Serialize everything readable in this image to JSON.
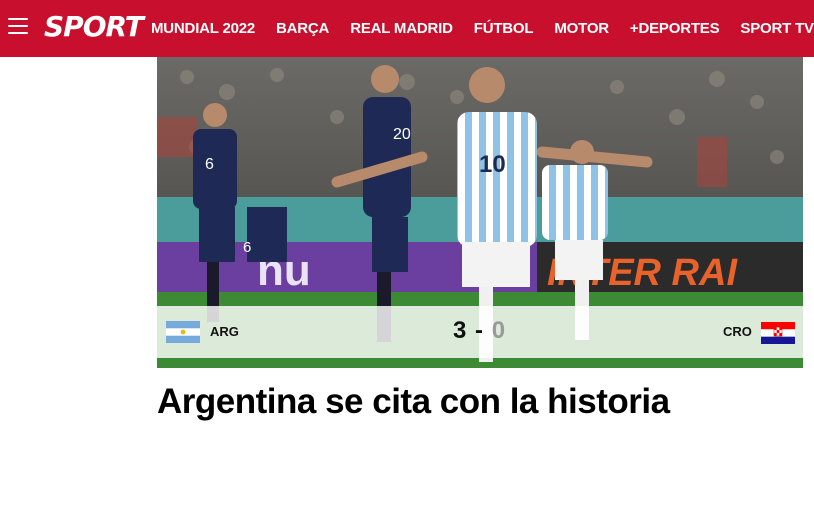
{
  "header": {
    "logo_text": "SPORT",
    "nav": [
      "MUNDIAL 2022",
      "BARÇA",
      "REAL MADRID",
      "FÚTBOL",
      "MOTOR",
      "+DEPORTES",
      "SPORT TV"
    ],
    "brand_color": "#c8102e"
  },
  "hero": {
    "jersey_numbers": [
      "6",
      "20",
      "10",
      "6"
    ],
    "board_texts": [
      "nu",
      "INTER RAI"
    ]
  },
  "match": {
    "home_team": "ARG",
    "home_score": "3",
    "separator": "-",
    "away_score": "0",
    "away_team": "CRO"
  },
  "article": {
    "headline": "Argentina se cita con la historia"
  }
}
